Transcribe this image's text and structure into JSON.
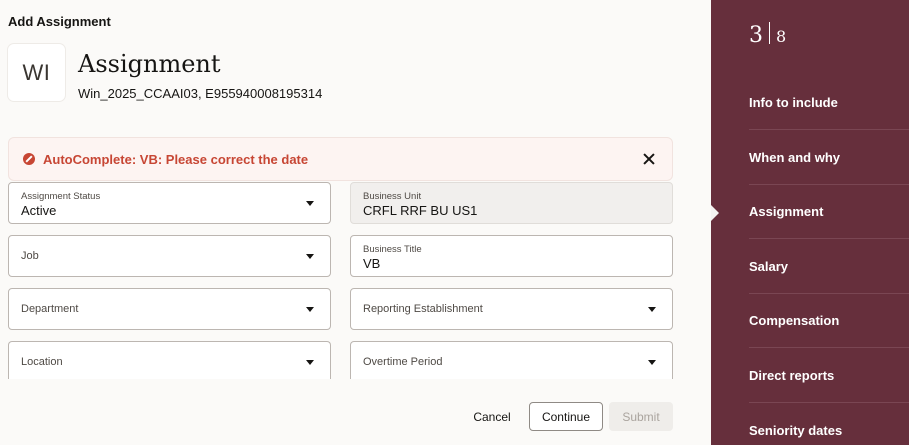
{
  "page": {
    "header": "Add Assignment",
    "avatar_initials": "WI",
    "title": "Assignment",
    "subtitle": "Win_2025_CCAAI03, E955940008195314"
  },
  "error": {
    "message": "AutoComplete: VB: Please correct the date",
    "color": "#c74634"
  },
  "fields": {
    "assignment_status": {
      "label": "Assignment Status",
      "value": "Active"
    },
    "business_unit": {
      "label": "Business Unit",
      "value": "CRFL RRF BU US1"
    },
    "job": {
      "label": "Job"
    },
    "business_title": {
      "label": "Business Title",
      "value": "VB"
    },
    "department": {
      "label": "Department"
    },
    "reporting_establishment": {
      "label": "Reporting Establishment"
    },
    "location": {
      "label": "Location"
    },
    "overtime_period": {
      "label": "Overtime Period"
    }
  },
  "footer": {
    "cancel": "Cancel",
    "continue": "Continue",
    "submit": "Submit"
  },
  "sidebar": {
    "color": "#662f3c",
    "current_step": "3",
    "total_steps": "8",
    "items": [
      {
        "label": "Info to include"
      },
      {
        "label": "When and why"
      },
      {
        "label": "Assignment",
        "active": true
      },
      {
        "label": "Salary"
      },
      {
        "label": "Compensation"
      },
      {
        "label": "Direct reports"
      },
      {
        "label": "Seniority dates"
      }
    ]
  }
}
